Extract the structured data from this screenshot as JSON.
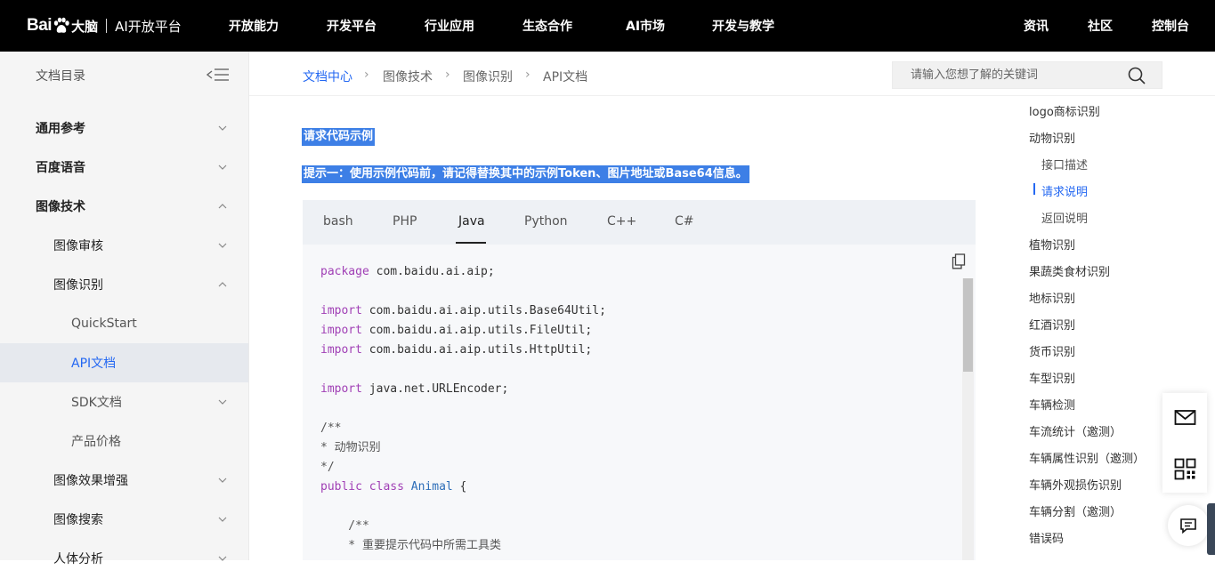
{
  "topnav": {
    "logo": {
      "bai": "Bai",
      "du": "大脑",
      "platform": "AI开放平台"
    },
    "items": [
      "开放能力",
      "开发平台",
      "行业应用",
      "生态合作",
      "AI市场",
      "开发与教学"
    ],
    "right_items": [
      "资讯",
      "社区",
      "控制台"
    ]
  },
  "sidebar": {
    "title": "文档目录",
    "items": [
      {
        "label": "通用参考"
      },
      {
        "label": "百度语音"
      },
      {
        "label": "图像技术"
      },
      {
        "label": "图像审核"
      },
      {
        "label": "图像识别"
      },
      {
        "label": "QuickStart"
      },
      {
        "label": "API文档"
      },
      {
        "label": "SDK文档"
      },
      {
        "label": "产品价格"
      },
      {
        "label": "图像效果增强"
      },
      {
        "label": "图像搜索"
      },
      {
        "label": "人体分析"
      }
    ]
  },
  "breadcrumb": [
    "文档中心",
    "图像技术",
    "图像识别",
    "API文档"
  ],
  "search": {
    "placeholder": "请输入您想了解的关键词"
  },
  "content": {
    "heading": "请求代码示例",
    "tip": "提示一：使用示例代码前，请记得替换其中的示例Token、图片地址或Base64信息。"
  },
  "code_tabs": {
    "tabs": [
      "bash",
      "PHP",
      "Java",
      "Python",
      "C++",
      "C#"
    ],
    "active": "Java"
  },
  "code": {
    "l1_kw": "package",
    "l1_rest": " com.baidu.ai.aip;",
    "l2_kw": "import",
    "l2_rest": " com.baidu.ai.aip.utils.Base64Util;",
    "l3_kw": "import",
    "l3_rest": " com.baidu.ai.aip.utils.FileUtil;",
    "l4_kw": "import",
    "l4_rest": " com.baidu.ai.aip.utils.HttpUtil;",
    "l5_kw": "import",
    "l5_rest": " java.net.URLEncoder;",
    "c1": "/**",
    "c2": "* 动物识别",
    "c3": "*/",
    "cls_kw1": "public",
    "cls_kw2": "class",
    "cls_name": "Animal",
    "cls_brace": " {",
    "c4": "    /**",
    "c5": "    * 重要提示代码中所需工具类"
  },
  "toc": {
    "items": [
      {
        "label": "logo商标识别"
      },
      {
        "label": "动物识别"
      },
      {
        "label": "接口描述"
      },
      {
        "label": "请求说明"
      },
      {
        "label": "返回说明"
      },
      {
        "label": "植物识别"
      },
      {
        "label": "果蔬类食材识别"
      },
      {
        "label": "地标识别"
      },
      {
        "label": "红酒识别"
      },
      {
        "label": "货币识别"
      },
      {
        "label": "车型识别"
      },
      {
        "label": "车辆检测"
      },
      {
        "label": "车流统计（邀测）"
      },
      {
        "label": "车辆属性识别（邀测）"
      },
      {
        "label": "车辆外观损伤识别"
      },
      {
        "label": "车辆分割（邀测）"
      },
      {
        "label": "错误码"
      }
    ]
  },
  "colors": {
    "accent": "#2468f2",
    "highlight": "#3d7fe6",
    "nav_bg": "#000000"
  }
}
